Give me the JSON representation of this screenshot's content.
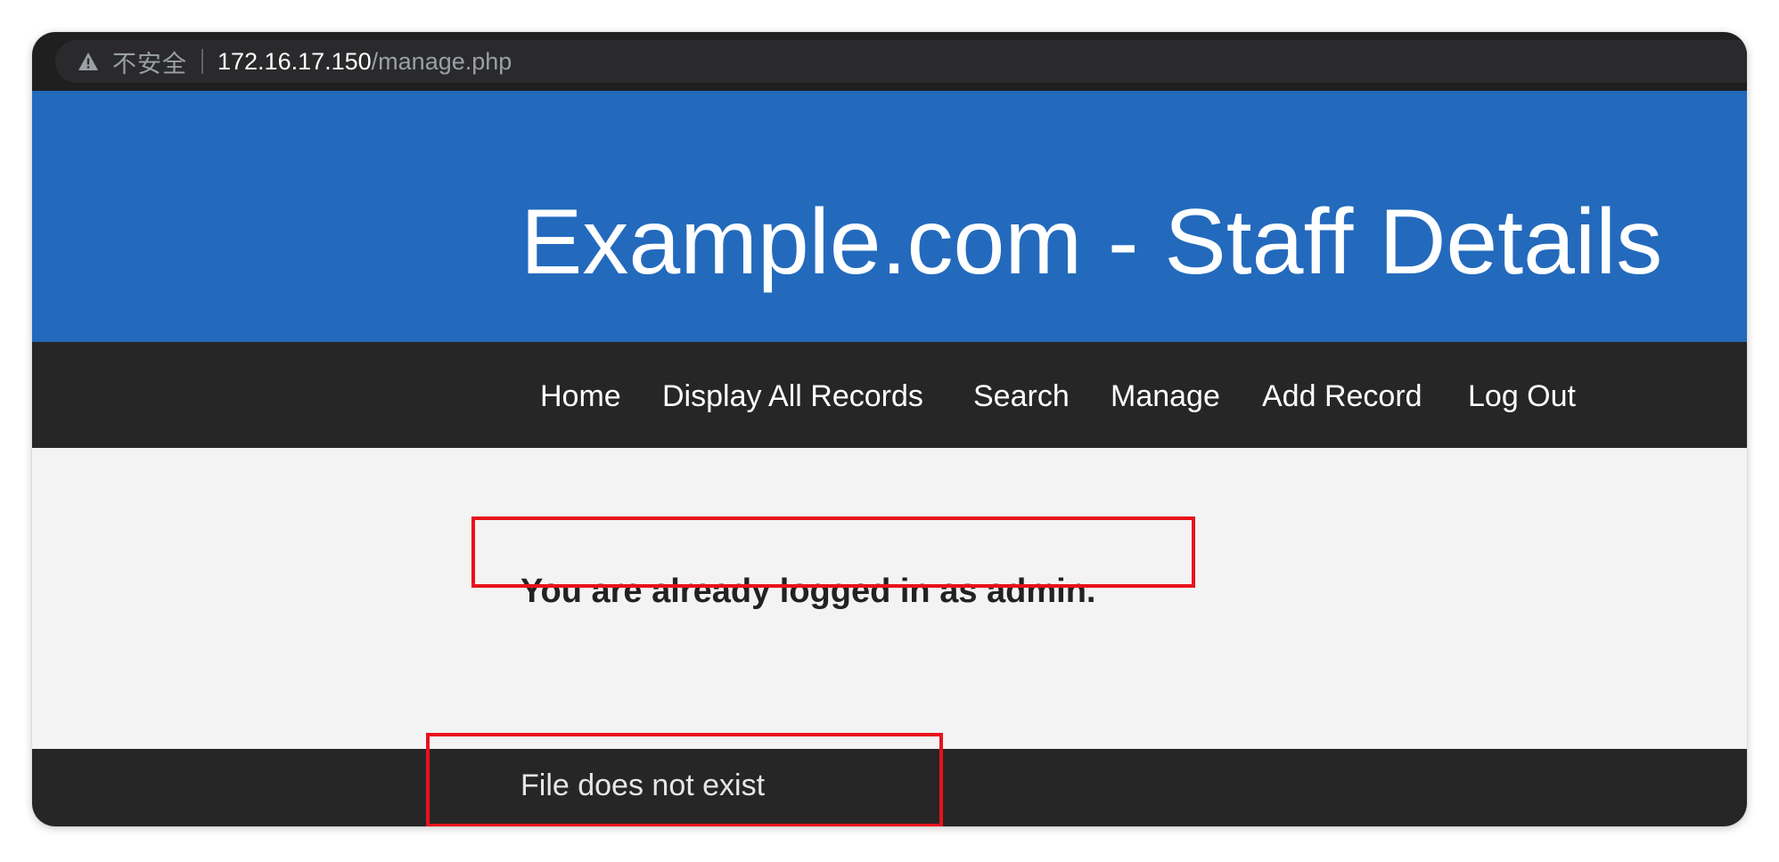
{
  "browser": {
    "security_label": "不安全",
    "url_host": "172.16.17.150",
    "url_path": "/manage.php",
    "security_icon": "warning-triangle-icon"
  },
  "site": {
    "title": "Example.com - Staff Details"
  },
  "nav": {
    "items": [
      {
        "label": "Home"
      },
      {
        "label": "Display All Records"
      },
      {
        "label": "Search"
      },
      {
        "label": "Manage"
      },
      {
        "label": "Add Record"
      },
      {
        "label": "Log Out"
      }
    ]
  },
  "main": {
    "status_message": "You are already logged in as admin."
  },
  "footer": {
    "message": "File does not exist"
  },
  "colors": {
    "header_bg": "#236abd",
    "nav_bg": "#262626",
    "content_bg": "#f3f3f3",
    "annotation": "#e8121b"
  }
}
